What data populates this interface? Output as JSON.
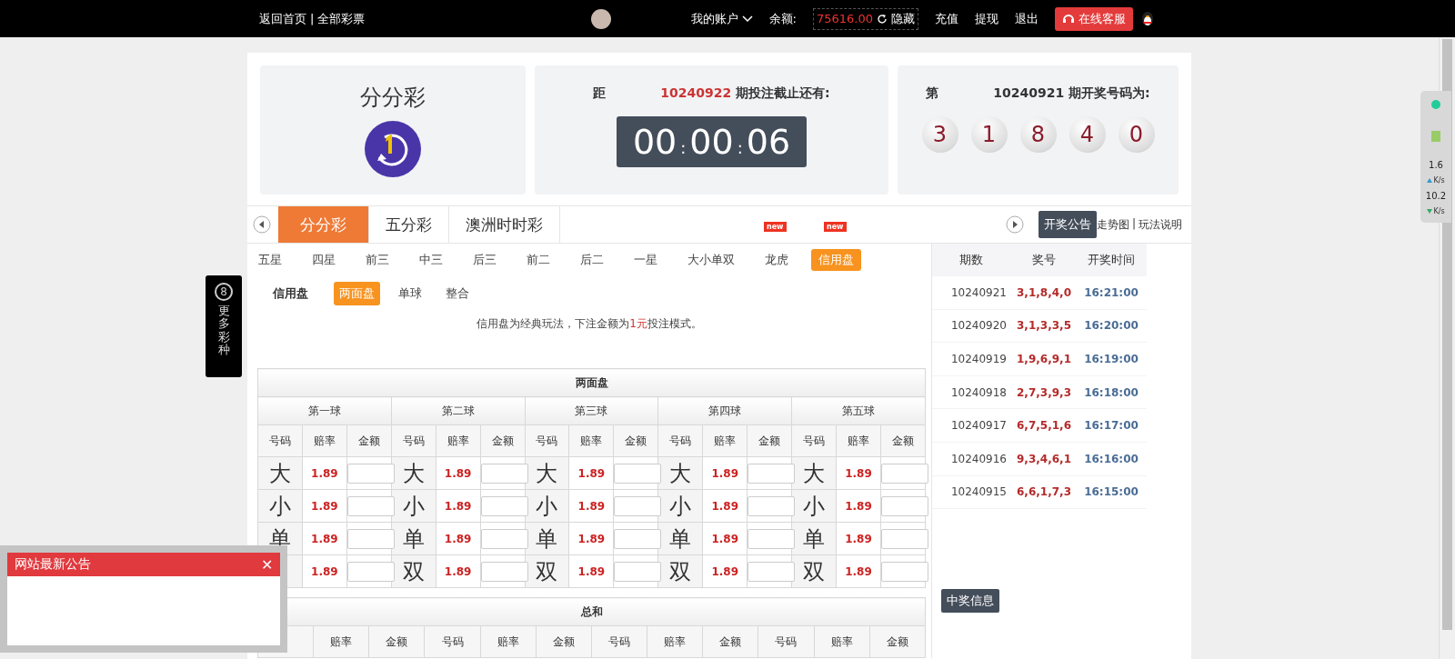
{
  "topbar": {
    "nav_links": [
      "返回首页",
      "全部彩票"
    ],
    "nav_separator": "|",
    "account_menu": "我的账户",
    "balance_label": "余额:",
    "balance": "75616.00",
    "hide_link": "隐藏",
    "links": [
      "充值",
      "提现",
      "退出"
    ],
    "service_button": "在线客服"
  },
  "game_card": {
    "name": "分分彩"
  },
  "countdown_card": {
    "prefix": "距",
    "period": "10240922",
    "suffix": "期投注截止还有:",
    "time": [
      "00",
      "00",
      "06"
    ],
    "time_separator": ":"
  },
  "draw_card": {
    "prefix": "第",
    "period": "10240921",
    "suffix": "期开奖号码为:",
    "balls": [
      "3",
      "1",
      "8",
      "4",
      "0"
    ]
  },
  "game_tabs": [
    {
      "label": "分分彩",
      "selected": true
    },
    {
      "label": "五分彩",
      "selected": false
    },
    {
      "label": "澳洲时时彩",
      "selected": false
    }
  ],
  "new_badges": [
    "new",
    "new"
  ],
  "announcement_button": "开奖公告",
  "header_links": [
    "走势图",
    "玩法说明"
  ],
  "header_link_separator": "|",
  "play_tabs": [
    {
      "label": "五星",
      "selected": false
    },
    {
      "label": "四星",
      "selected": false
    },
    {
      "label": "前三",
      "selected": false
    },
    {
      "label": "中三",
      "selected": false
    },
    {
      "label": "后三",
      "selected": false
    },
    {
      "label": "前二",
      "selected": false
    },
    {
      "label": "后二",
      "selected": false
    },
    {
      "label": "一星",
      "selected": false
    },
    {
      "label": "大小单双",
      "selected": false
    },
    {
      "label": "龙虎",
      "selected": false
    },
    {
      "label": "信用盘",
      "selected": true
    }
  ],
  "sub_tabs": {
    "heading": "信用盘",
    "items": [
      {
        "label": "两面盘",
        "selected": true
      },
      {
        "label": "单球",
        "selected": false
      },
      {
        "label": "整合",
        "selected": false
      }
    ]
  },
  "description": {
    "before": "信用盘为经典玩法，下注金额为",
    "highlight": "1元",
    "after": "投注模式。"
  },
  "bet_table": {
    "title": "两面盘",
    "groups": [
      {
        "name": "第一球",
        "columns": [
          "号码",
          "赔率",
          "金额"
        ],
        "items": [
          {
            "code": "大",
            "odds": "1.89"
          },
          {
            "code": "小",
            "odds": "1.89"
          },
          {
            "code": "单",
            "odds": "1.89"
          },
          {
            "odds": "1.89"
          }
        ]
      },
      {
        "name": "第二球",
        "columns": [
          "号码",
          "赔率",
          "金额"
        ],
        "items": [
          {
            "code": "大",
            "odds": "1.89"
          },
          {
            "code": "小",
            "odds": "1.89"
          },
          {
            "code": "单",
            "odds": "1.89"
          },
          {
            "code": "双",
            "odds": "1.89"
          }
        ]
      },
      {
        "name": "第三球",
        "columns": [
          "号码",
          "赔率",
          "金额"
        ],
        "items": [
          {
            "code": "大",
            "odds": "1.89"
          },
          {
            "code": "小",
            "odds": "1.89"
          },
          {
            "code": "单",
            "odds": "1.89"
          },
          {
            "code": "双",
            "odds": "1.89"
          }
        ]
      },
      {
        "name": "第四球",
        "columns": [
          "号码",
          "赔率",
          "金额"
        ],
        "items": [
          {
            "code": "大",
            "odds": "1.89"
          },
          {
            "code": "小",
            "odds": "1.89"
          },
          {
            "code": "单",
            "odds": "1.89"
          },
          {
            "code": "双",
            "odds": "1.89"
          }
        ]
      },
      {
        "name": "第五球",
        "columns": [
          "号码",
          "赔率",
          "金额"
        ],
        "items": [
          {
            "code": "大",
            "odds": "1.89"
          },
          {
            "code": "小",
            "odds": "1.89"
          },
          {
            "code": "单",
            "odds": "1.89"
          },
          {
            "code": "双",
            "odds": "1.89"
          }
        ]
      }
    ]
  },
  "sum_table": {
    "title": "总和",
    "groups": [
      {
        "columns": [
          "赔率",
          "金额"
        ]
      },
      {
        "columns": [
          "号码",
          "赔率",
          "金额"
        ]
      },
      {
        "columns": [
          "号码",
          "赔率",
          "金额"
        ]
      },
      {
        "columns": [
          "号码",
          "赔率",
          "金额"
        ]
      }
    ]
  },
  "results": {
    "columns": [
      "期数",
      "奖号",
      "开奖时间"
    ],
    "rows": [
      {
        "period": "10240921",
        "numbers": "3,1,8,4,0",
        "time": "16:21:00"
      },
      {
        "period": "10240920",
        "numbers": "3,1,3,3,5",
        "time": "16:20:00"
      },
      {
        "period": "10240919",
        "numbers": "1,9,6,9,1",
        "time": "16:19:00"
      },
      {
        "period": "10240918",
        "numbers": "2,7,3,9,3",
        "time": "16:18:00"
      },
      {
        "period": "10240917",
        "numbers": "6,7,5,1,6",
        "time": "16:17:00"
      },
      {
        "period": "10240916",
        "numbers": "9,3,4,6,1",
        "time": "16:16:00"
      },
      {
        "period": "10240915",
        "numbers": "6,6,1,7,3",
        "time": "16:15:00"
      }
    ],
    "winners_button": "中奖信息"
  },
  "side_tab": {
    "icon_text": "8",
    "label": "更多彩种"
  },
  "notice_popup": {
    "title": "网站最新公告",
    "close": "✕"
  },
  "speed_widget": [
    {
      "value": "1.6",
      "unit": "K/s"
    },
    {
      "value": "10.2",
      "unit": "K/s"
    }
  ]
}
